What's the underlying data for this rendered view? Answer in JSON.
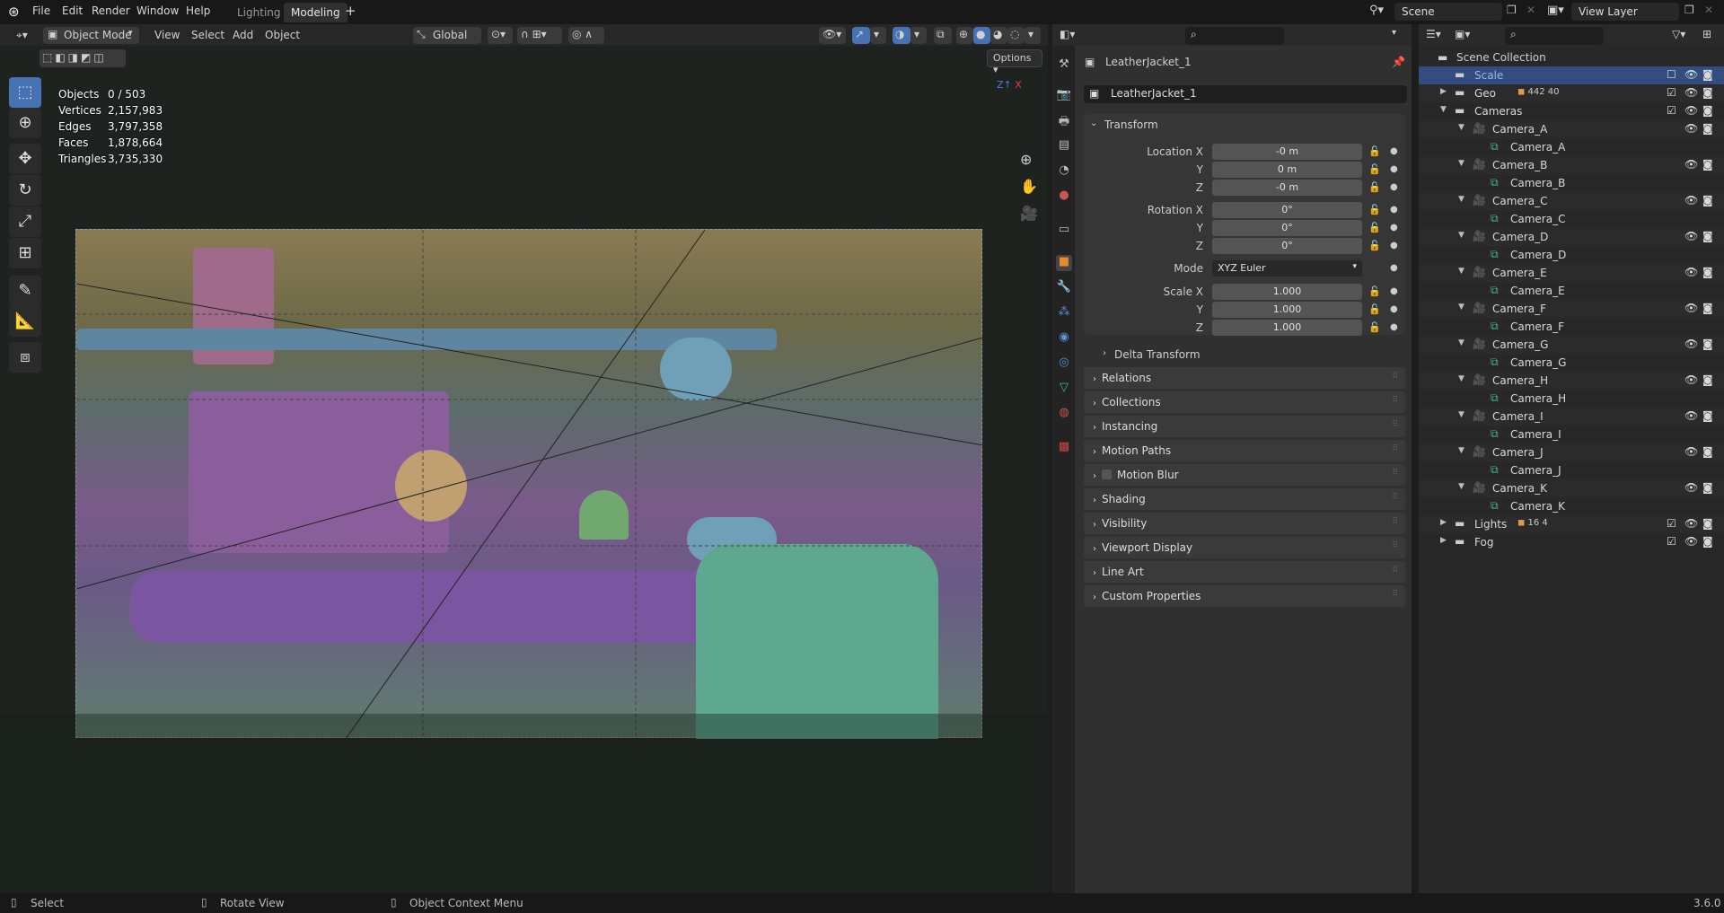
{
  "menu": {
    "items": [
      "File",
      "Edit",
      "Render",
      "Window",
      "Help"
    ],
    "tabs": [
      "Lighting",
      "Modeling"
    ],
    "active_tab": "Modeling",
    "add_tab": "+"
  },
  "scene": {
    "name": "Scene",
    "view_layer": "View Layer"
  },
  "viewport": {
    "mode": "Object Mode",
    "menus": [
      "View",
      "Select",
      "Add",
      "Object"
    ],
    "orientation": "Global",
    "options": "Options",
    "stats": [
      {
        "label": "Objects",
        "value": "0 / 503"
      },
      {
        "label": "Vertices",
        "value": "2,157,983"
      },
      {
        "label": "Edges",
        "value": "3,797,358"
      },
      {
        "label": "Faces",
        "value": "1,878,664"
      },
      {
        "label": "Triangles",
        "value": "3,735,330"
      }
    ]
  },
  "properties": {
    "object_name": "LeatherJacket_1",
    "data_name": "LeatherJacket_1",
    "transform": "Transform",
    "location": {
      "label_x": "Location X",
      "label_y": "Y",
      "label_z": "Z",
      "x": "-0 m",
      "y": "0 m",
      "z": "-0 m"
    },
    "rotation": {
      "label_x": "Rotation X",
      "label_y": "Y",
      "label_z": "Z",
      "x": "0°",
      "y": "0°",
      "z": "0°"
    },
    "mode_label": "Mode",
    "mode": "XYZ Euler",
    "scale": {
      "label_x": "Scale X",
      "label_y": "Y",
      "label_z": "Z",
      "x": "1.000",
      "y": "1.000",
      "z": "1.000"
    },
    "delta": "Delta Transform",
    "panels": [
      "Relations",
      "Collections",
      "Instancing",
      "Motion Paths",
      "Motion Blur",
      "Shading",
      "Visibility",
      "Viewport Display",
      "Line Art",
      "Custom Properties"
    ]
  },
  "outliner": {
    "root": "Scene Collection",
    "rows": [
      {
        "name": "Scale",
        "level": 1,
        "type": "collection",
        "selected": true
      },
      {
        "name": "Geo",
        "level": 1,
        "type": "collection",
        "expand": "closed",
        "badge": "442 40",
        "check": true
      },
      {
        "name": "Cameras",
        "level": 1,
        "type": "collection",
        "expand": "open",
        "check": true
      },
      {
        "name": "Camera_A",
        "level": 2,
        "type": "camera",
        "expand": "open"
      },
      {
        "name": "Camera_A",
        "level": 3,
        "type": "camdata"
      },
      {
        "name": "Camera_B",
        "level": 2,
        "type": "camera",
        "expand": "open"
      },
      {
        "name": "Camera_B",
        "level": 3,
        "type": "camdata"
      },
      {
        "name": "Camera_C",
        "level": 2,
        "type": "camera",
        "expand": "open"
      },
      {
        "name": "Camera_C",
        "level": 3,
        "type": "camdata"
      },
      {
        "name": "Camera_D",
        "level": 2,
        "type": "camera",
        "expand": "open"
      },
      {
        "name": "Camera_D",
        "level": 3,
        "type": "camdata"
      },
      {
        "name": "Camera_E",
        "level": 2,
        "type": "camera",
        "expand": "open"
      },
      {
        "name": "Camera_E",
        "level": 3,
        "type": "camdata"
      },
      {
        "name": "Camera_F",
        "level": 2,
        "type": "camera",
        "expand": "open"
      },
      {
        "name": "Camera_F",
        "level": 3,
        "type": "camdata"
      },
      {
        "name": "Camera_G",
        "level": 2,
        "type": "camera",
        "expand": "open"
      },
      {
        "name": "Camera_G",
        "level": 3,
        "type": "camdata"
      },
      {
        "name": "Camera_H",
        "level": 2,
        "type": "camera",
        "expand": "open"
      },
      {
        "name": "Camera_H",
        "level": 3,
        "type": "camdata"
      },
      {
        "name": "Camera_I",
        "level": 2,
        "type": "camera",
        "expand": "open"
      },
      {
        "name": "Camera_I",
        "level": 3,
        "type": "camdata"
      },
      {
        "name": "Camera_J",
        "level": 2,
        "type": "camera",
        "expand": "open"
      },
      {
        "name": "Camera_J",
        "level": 3,
        "type": "camdata"
      },
      {
        "name": "Camera_K",
        "level": 2,
        "type": "camera",
        "expand": "open"
      },
      {
        "name": "Camera_K",
        "level": 3,
        "type": "camdata"
      },
      {
        "name": "Lights",
        "level": 1,
        "type": "collection",
        "expand": "closed",
        "badge": "16 4",
        "check": true
      },
      {
        "name": "Fog",
        "level": 1,
        "type": "collection",
        "expand": "closed",
        "check": true
      }
    ]
  },
  "status": {
    "select": "Select",
    "rotate": "Rotate View",
    "context": "Object Context Menu",
    "version": "3.6.0"
  },
  "colors": {
    "accent": "#4772b3",
    "camera_icon": "#e09a4c",
    "camdata_icon": "#3fb58a"
  }
}
